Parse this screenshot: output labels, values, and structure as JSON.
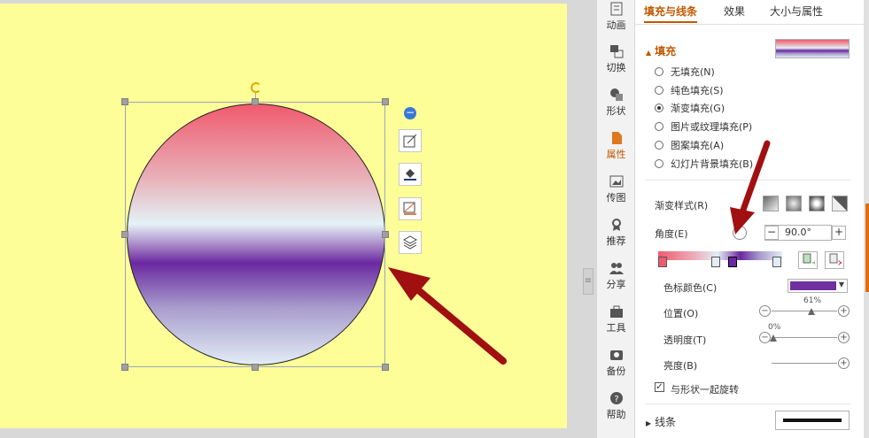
{
  "sidebar": {
    "items": [
      {
        "label": "动画",
        "icon": "animation-icon"
      },
      {
        "label": "切换",
        "icon": "transition-icon"
      },
      {
        "label": "形状",
        "icon": "shape-icon"
      },
      {
        "label": "属性",
        "icon": "property-icon"
      },
      {
        "label": "传图",
        "icon": "upload-image-icon"
      },
      {
        "label": "推荐",
        "icon": "recommend-icon"
      },
      {
        "label": "分享",
        "icon": "share-icon"
      },
      {
        "label": "工具",
        "icon": "toolbox-icon"
      },
      {
        "label": "备份",
        "icon": "backup-icon"
      },
      {
        "label": "帮助",
        "icon": "help-icon"
      }
    ],
    "active": "属性"
  },
  "panel": {
    "tabs": [
      "填充与线条",
      "效果",
      "大小与属性"
    ],
    "fill_section": {
      "title": "填充",
      "options": [
        "无填充(N)",
        "纯色填充(S)",
        "渐变填充(G)",
        "图片或纹理填充(P)",
        "图案填充(A)",
        "幻灯片背景填充(B)"
      ],
      "selected": "渐变填充(G)"
    },
    "gradient": {
      "style_label": "渐变样式(R)",
      "angle_label": "角度(E)",
      "angle_value": "90.0°",
      "minus": "−",
      "plus": "+",
      "stop_color_label": "色标颜色(C)",
      "stop_color": "#7030a0",
      "position_label": "位置(O)",
      "position_value": "61%",
      "transparency_label": "透明度(T)",
      "transparency_value": "0%",
      "brightness_label": "亮度(B)",
      "rotate_with_shape_label": "与形状一起旋转"
    },
    "line_section": {
      "title": "线条"
    }
  },
  "colors": {
    "accent": "#c05800",
    "slide_bg": "#fefe99",
    "arrow": "#a01010"
  }
}
